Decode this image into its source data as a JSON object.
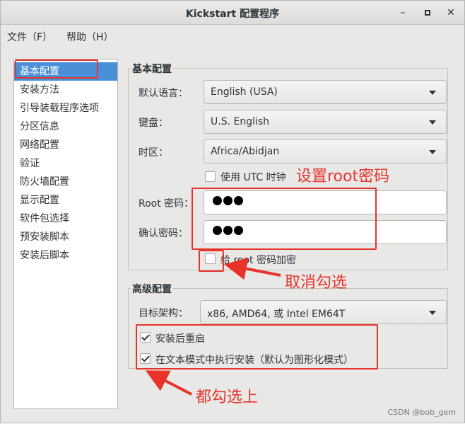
{
  "window": {
    "title": "Kickstart 配置程序",
    "controls": {
      "minimize": "–",
      "maximize": "▫",
      "close": "✕"
    }
  },
  "menubar": {
    "file": "文件（F）",
    "help": "帮助（H）"
  },
  "sidebar": {
    "items": [
      {
        "label": "基本配置",
        "selected": true
      },
      {
        "label": "安装方法"
      },
      {
        "label": "引导装载程序选项"
      },
      {
        "label": "分区信息"
      },
      {
        "label": "网络配置"
      },
      {
        "label": "验证"
      },
      {
        "label": "防火墙配置"
      },
      {
        "label": "显示配置"
      },
      {
        "label": "软件包选择"
      },
      {
        "label": "预安装脚本"
      },
      {
        "label": "安装后脚本"
      }
    ]
  },
  "basic": {
    "title": "基本配置",
    "language_label": "默认语言：",
    "language_value": "English (USA)",
    "keyboard_label": "键盘：",
    "keyboard_value": "U.S. English",
    "timezone_label": "时区：",
    "timezone_value": "Africa/Abidjan",
    "utc_label": "使用  UTC 时钟",
    "utc_checked": false,
    "root_password_label": "Root 密码：",
    "confirm_password_label": "确认密码：",
    "encrypt_label": "给  root 密码加密",
    "encrypt_checked": false
  },
  "advanced": {
    "title": "高级配置",
    "arch_label": "目标架构：",
    "arch_value": "x86, AMD64, 或  Intel EM64T",
    "reboot_label": "安装后重启",
    "reboot_checked": true,
    "textmode_label": "在文本模式中执行安装（默认为图形化模式）",
    "textmode_checked": true
  },
  "annotations": {
    "set_root_password": "设置root密码",
    "uncheck": "取消勾选",
    "check_all": "都勾选上",
    "color": "#e8332b"
  },
  "watermark": "CSDN @bob_gem",
  "colors": {
    "selection": "#4a90d9",
    "annotation": "#e8332b"
  }
}
